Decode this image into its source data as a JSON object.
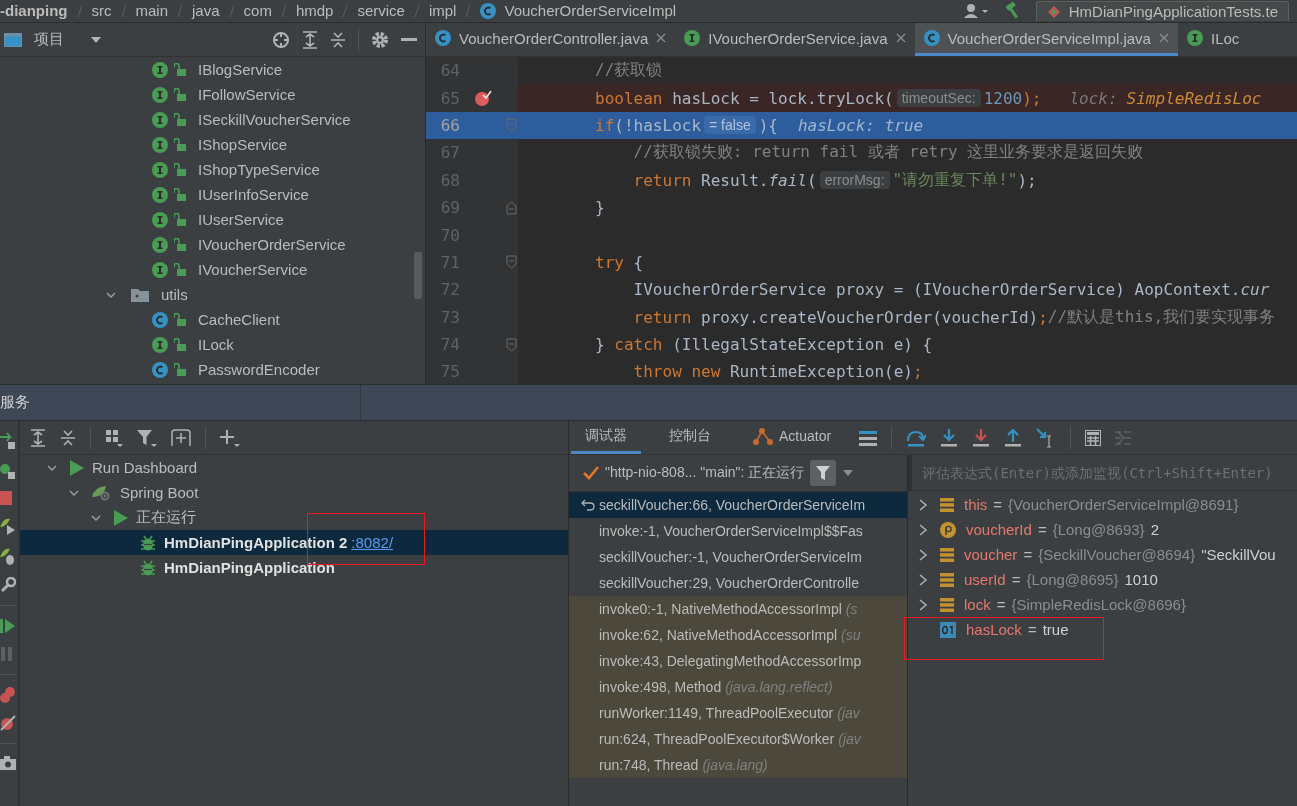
{
  "breadcrumb": {
    "items": [
      "-dianping",
      "src",
      "main",
      "java",
      "com",
      "hmdp",
      "service",
      "impl",
      "VoucherOrderServiceImpl"
    ],
    "run_config": "HmDianPingApplicationTests.te"
  },
  "project": {
    "title": "项目",
    "tree": [
      {
        "kind": "interface",
        "label": "IBlogService"
      },
      {
        "kind": "interface",
        "label": "IFollowService"
      },
      {
        "kind": "interface",
        "label": "ISeckillVoucherService"
      },
      {
        "kind": "interface",
        "label": "IShopService"
      },
      {
        "kind": "interface",
        "label": "IShopTypeService"
      },
      {
        "kind": "interface",
        "label": "IUserInfoService"
      },
      {
        "kind": "interface",
        "label": "IUserService"
      },
      {
        "kind": "interface",
        "label": "IVoucherOrderService"
      },
      {
        "kind": "interface",
        "label": "IVoucherService"
      },
      {
        "kind": "package",
        "label": "utils",
        "expanded": true,
        "children": [
          {
            "kind": "class",
            "label": "CacheClient"
          },
          {
            "kind": "interface",
            "label": "ILock"
          },
          {
            "kind": "class",
            "label": "PasswordEncoder"
          }
        ]
      }
    ]
  },
  "editor": {
    "tabs": [
      {
        "kind": "class",
        "label": "VoucherOrderController.java",
        "selected": false,
        "closable": true
      },
      {
        "kind": "interface",
        "label": "IVoucherOrderService.java",
        "selected": false,
        "closable": true
      },
      {
        "kind": "class",
        "label": "VoucherOrderServiceImpl.java",
        "selected": true,
        "closable": true
      },
      {
        "kind": "interface",
        "label": "ILoc",
        "selected": false,
        "closable": false
      }
    ],
    "lines": [
      {
        "number": "64",
        "breakpoint": false,
        "current": false,
        "fold_open": false,
        "fold_close": false,
        "segments": [
          {
            "kind": "comment",
            "text": "        //获取锁"
          }
        ]
      },
      {
        "number": "65",
        "breakpoint": true,
        "current": false,
        "fold_open": false,
        "fold_close": false,
        "segments": [
          {
            "kind": "keyword",
            "text": "        boolean"
          },
          {
            "kind": "plain",
            "text": " hasLock = lock.tryLock("
          },
          {
            "kind": "hint",
            "text": "timeoutSec:"
          },
          {
            "kind": "number",
            "text": "1200"
          },
          {
            "kind": "keyword",
            "text": ");"
          },
          {
            "kind": "inline-name",
            "text": "lock:"
          },
          {
            "kind": "inline-value",
            "text": "SimpleRedisLoc"
          }
        ]
      },
      {
        "number": "66",
        "breakpoint": false,
        "current": true,
        "fold_open": true,
        "fold_close": false,
        "segments": [
          {
            "kind": "keyword",
            "text": "        if"
          },
          {
            "kind": "plain",
            "text": "(!hasLock"
          },
          {
            "kind": "hint",
            "text": "= false"
          },
          {
            "kind": "plain",
            "text": "){"
          },
          {
            "kind": "inline",
            "text": "hasLock: true"
          }
        ]
      },
      {
        "number": "67",
        "breakpoint": false,
        "current": false,
        "fold_open": false,
        "fold_close": false,
        "segments": [
          {
            "kind": "comment",
            "text": "            //获取锁失败: return fail 或者 retry 这里业务要求是返回失败"
          }
        ]
      },
      {
        "number": "68",
        "breakpoint": false,
        "current": false,
        "fold_open": false,
        "fold_close": false,
        "segments": [
          {
            "kind": "keyword",
            "text": "            return"
          },
          {
            "kind": "plain",
            "text": " Result."
          },
          {
            "kind": "italic",
            "text": "fail"
          },
          {
            "kind": "plain",
            "text": "("
          },
          {
            "kind": "hint",
            "text": "errorMsg:"
          },
          {
            "kind": "string",
            "text": "\"请勿重复下单!\""
          },
          {
            "kind": "plain",
            "text": ");"
          }
        ]
      },
      {
        "number": "69",
        "breakpoint": false,
        "current": false,
        "fold_open": false,
        "fold_close": true,
        "segments": [
          {
            "kind": "plain",
            "text": "        }"
          }
        ]
      },
      {
        "number": "70",
        "breakpoint": false,
        "current": false,
        "fold_open": false,
        "fold_close": false
      },
      {
        "number": "71",
        "breakpoint": false,
        "current": false,
        "fold_open": true,
        "fold_close": false,
        "segments": [
          {
            "kind": "keyword",
            "text": "        try"
          },
          {
            "kind": "plain",
            "text": " {"
          }
        ]
      },
      {
        "number": "72",
        "breakpoint": false,
        "current": false,
        "fold_open": false,
        "fold_close": false,
        "segments": [
          {
            "kind": "plain",
            "text": "            IVoucherOrderService proxy = (IVoucherOrderService) AopContext."
          },
          {
            "kind": "italic",
            "text": "cur"
          }
        ]
      },
      {
        "number": "73",
        "breakpoint": false,
        "current": false,
        "fold_open": false,
        "fold_close": false,
        "segments": [
          {
            "kind": "keyword",
            "text": "            return"
          },
          {
            "kind": "plain",
            "text": " proxy.createVoucherOrder(voucherId)"
          },
          {
            "kind": "keyword",
            "text": ";"
          },
          {
            "kind": "comment",
            "text": "//默认是this,我们要实现事务"
          }
        ]
      },
      {
        "number": "74",
        "breakpoint": false,
        "current": false,
        "fold_open": true,
        "fold_close": false,
        "segments": [
          {
            "kind": "plain",
            "text": "        } "
          },
          {
            "kind": "keyword",
            "text": "catch"
          },
          {
            "kind": "plain",
            "text": " (IllegalStateException e) {"
          }
        ]
      },
      {
        "number": "75",
        "breakpoint": false,
        "current": false,
        "fold_open": false,
        "fold_close": false,
        "segments": [
          {
            "kind": "keyword",
            "text": "            throw new"
          },
          {
            "kind": "plain",
            "text": " RuntimeException(e)"
          },
          {
            "kind": "keyword",
            "text": ";"
          }
        ]
      }
    ]
  },
  "services": {
    "title": "服务",
    "tree": [
      {
        "kind": "group",
        "label": "Run Dashboard",
        "expanded": true,
        "selected": false,
        "marked": false,
        "children": [
          {
            "kind": "spring",
            "label": "Spring Boot",
            "expanded": true,
            "selected": false,
            "marked": false,
            "children": [
              {
                "kind": "status",
                "label": "正在运行",
                "expanded": true,
                "selected": false,
                "marked": false,
                "children": [
                  {
                    "kind": "app",
                    "label": "HmDianPingApplication 2",
                    "link": ":8082/",
                    "selected": true,
                    "marked": true
                  },
                  {
                    "kind": "app",
                    "label": "HmDianPingApplication",
                    "selected": false,
                    "marked": false
                  }
                ]
              }
            ]
          }
        ]
      }
    ]
  },
  "debugger": {
    "tabs": [
      {
        "kind": "text",
        "label": "调试器",
        "selected": true
      },
      {
        "kind": "text",
        "label": "控制台",
        "selected": false
      },
      {
        "kind": "actuator",
        "label": "Actuator",
        "selected": false
      }
    ],
    "thread": "\"http-nio-808... \"main\": 正在运行",
    "frames": [
      {
        "kind": "app",
        "text": "seckillVoucher:66, VoucherOrderServiceIm",
        "selected": true
      },
      {
        "kind": "app",
        "text": "invoke:-1, VoucherOrderServiceImpl$$Fas",
        "selected": false
      },
      {
        "kind": "app",
        "text": "seckillVoucher:-1, VoucherOrderServiceIm",
        "selected": false
      },
      {
        "kind": "app",
        "text": "seckillVoucher:29, VoucherOrderControlle",
        "selected": false
      },
      {
        "kind": "library",
        "text": "invoke0:-1, NativeMethodAccessorImpl",
        "package": "(s",
        "selected": false
      },
      {
        "kind": "library",
        "text": "invoke:62, NativeMethodAccessorImpl",
        "package": "(su",
        "selected": false
      },
      {
        "kind": "library",
        "text": "invoke:43, DelegatingMethodAccessorImp",
        "selected": false
      },
      {
        "kind": "library",
        "text": "invoke:498, Method",
        "package": "(java.lang.reflect)",
        "selected": false
      },
      {
        "kind": "library",
        "text": "runWorker:1149, ThreadPoolExecutor",
        "package": "(jav",
        "selected": false
      },
      {
        "kind": "library",
        "text": "run:624, ThreadPoolExecutor$Worker",
        "package": "(jav",
        "selected": false
      },
      {
        "kind": "library",
        "text": "run:748, Thread",
        "package": "(java.lang)",
        "selected": false
      }
    ],
    "eval_placeholder": "评估表达式(Enter)或添加监视(Ctrl+Shift+Enter)",
    "variables": [
      {
        "kind": "object",
        "name": "this",
        "equals": "=",
        "type": "{VoucherOrderServiceImpl@8691}",
        "expandable": true,
        "marked": false
      },
      {
        "kind": "parameter",
        "name": "voucherId",
        "equals": "=",
        "type": "{Long@8693}",
        "value": "2",
        "expandable": true,
        "marked": false
      },
      {
        "kind": "object",
        "name": "voucher",
        "equals": "=",
        "type": "{SeckillVoucher@8694}",
        "value": "\"SeckillVou",
        "expandable": true,
        "marked": false
      },
      {
        "kind": "object",
        "name": "userId",
        "equals": "=",
        "type": "{Long@8695}",
        "value": "1010",
        "expandable": true,
        "marked": false
      },
      {
        "kind": "object",
        "name": "lock",
        "equals": "=",
        "type": "{SimpleRedisLock@8696}",
        "expandable": true,
        "marked": false
      },
      {
        "kind": "boolean",
        "name": "hasLock",
        "equals": "=",
        "value": "true",
        "expandable": false,
        "marked": true
      }
    ]
  }
}
